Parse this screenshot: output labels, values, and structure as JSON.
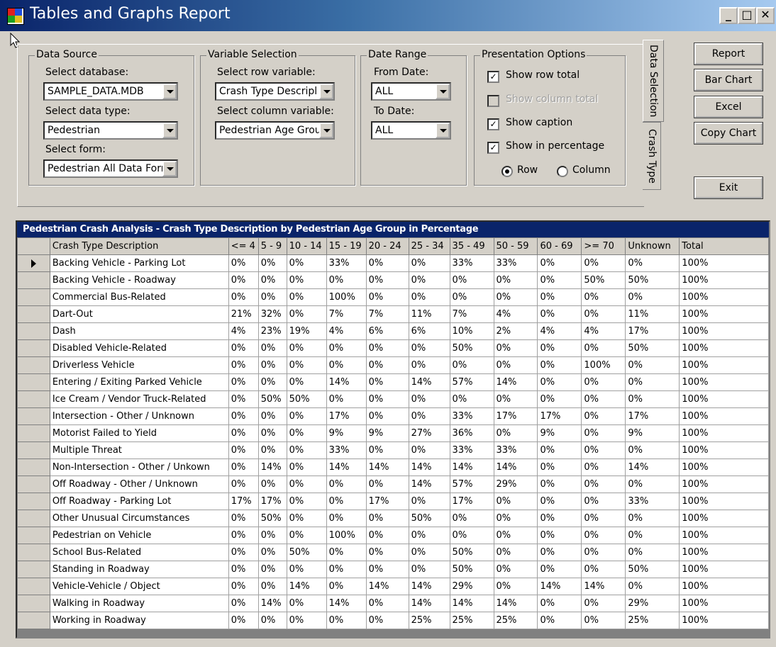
{
  "window": {
    "title": "Tables and Graphs Report"
  },
  "data_source": {
    "legend": "Data Source",
    "database_label": "Select database:",
    "database_value": "SAMPLE_DATA.MDB",
    "data_type_label": "Select data type:",
    "data_type_value": "Pedestrian",
    "form_label": "Select form:",
    "form_value": "Pedestrian All Data Forr"
  },
  "variable_selection": {
    "legend": "Variable Selection",
    "row_label": "Select row variable:",
    "row_value": "Crash Type Descripl",
    "column_label": "Select column variable:",
    "column_value": "Pedestrian Age Grou"
  },
  "date_range": {
    "legend": "Date Range",
    "from_label": "From Date:",
    "from_value": "ALL",
    "to_label": "To Date:",
    "to_value": "ALL"
  },
  "presentation": {
    "legend": "Presentation Options",
    "row_total": "Show row total",
    "column_total": "Show column total",
    "caption": "Show caption",
    "percentage": "Show in percentage",
    "row_radio": "Row",
    "column_radio": "Column"
  },
  "tabs": {
    "data_selection": "Data Selection",
    "crash_type": "Crash Type"
  },
  "buttons": {
    "report": "Report",
    "bar_chart": "Bar Chart",
    "excel": "Excel",
    "copy_chart": "Copy Chart",
    "exit": "Exit"
  },
  "grid": {
    "caption": "Pedestrian Crash Analysis - Crash Type Description by Pedestrian Age Group in Percentage",
    "columns": [
      "Crash Type Description",
      "<= 4",
      "5 - 9",
      "10 - 14",
      "15 - 19",
      "20 - 24",
      "25 - 34",
      "35 - 49",
      "50 - 59",
      "60 - 69",
      ">= 70",
      "Unknown",
      "Total"
    ],
    "rows": [
      [
        "Backing Vehicle - Parking Lot",
        "0%",
        "0%",
        "0%",
        "33%",
        "0%",
        "0%",
        "33%",
        "33%",
        "0%",
        "0%",
        "0%",
        "100%"
      ],
      [
        "Backing Vehicle - Roadway",
        "0%",
        "0%",
        "0%",
        "0%",
        "0%",
        "0%",
        "0%",
        "0%",
        "0%",
        "50%",
        "50%",
        "100%"
      ],
      [
        "Commercial Bus-Related",
        "0%",
        "0%",
        "0%",
        "100%",
        "0%",
        "0%",
        "0%",
        "0%",
        "0%",
        "0%",
        "0%",
        "100%"
      ],
      [
        "Dart-Out",
        "21%",
        "32%",
        "0%",
        "7%",
        "7%",
        "11%",
        "7%",
        "4%",
        "0%",
        "0%",
        "11%",
        "100%"
      ],
      [
        "Dash",
        "4%",
        "23%",
        "19%",
        "4%",
        "6%",
        "6%",
        "10%",
        "2%",
        "4%",
        "4%",
        "17%",
        "100%"
      ],
      [
        "Disabled Vehicle-Related",
        "0%",
        "0%",
        "0%",
        "0%",
        "0%",
        "0%",
        "50%",
        "0%",
        "0%",
        "0%",
        "50%",
        "100%"
      ],
      [
        "Driverless Vehicle",
        "0%",
        "0%",
        "0%",
        "0%",
        "0%",
        "0%",
        "0%",
        "0%",
        "0%",
        "100%",
        "0%",
        "100%"
      ],
      [
        "Entering / Exiting Parked Vehicle",
        "0%",
        "0%",
        "0%",
        "14%",
        "0%",
        "14%",
        "57%",
        "14%",
        "0%",
        "0%",
        "0%",
        "100%"
      ],
      [
        "Ice Cream / Vendor Truck-Related",
        "0%",
        "50%",
        "50%",
        "0%",
        "0%",
        "0%",
        "0%",
        "0%",
        "0%",
        "0%",
        "0%",
        "100%"
      ],
      [
        "Intersection - Other / Unknown",
        "0%",
        "0%",
        "0%",
        "17%",
        "0%",
        "0%",
        "33%",
        "17%",
        "17%",
        "0%",
        "17%",
        "100%"
      ],
      [
        "Motorist Failed to Yield",
        "0%",
        "0%",
        "0%",
        "9%",
        "9%",
        "27%",
        "36%",
        "0%",
        "9%",
        "0%",
        "9%",
        "100%"
      ],
      [
        "Multiple Threat",
        "0%",
        "0%",
        "0%",
        "33%",
        "0%",
        "0%",
        "33%",
        "33%",
        "0%",
        "0%",
        "0%",
        "100%"
      ],
      [
        "Non-Intersection - Other / Unkown",
        "0%",
        "14%",
        "0%",
        "14%",
        "14%",
        "14%",
        "14%",
        "14%",
        "0%",
        "0%",
        "14%",
        "100%"
      ],
      [
        "Off Roadway - Other / Unknown",
        "0%",
        "0%",
        "0%",
        "0%",
        "0%",
        "14%",
        "57%",
        "29%",
        "0%",
        "0%",
        "0%",
        "100%"
      ],
      [
        "Off Roadway - Parking Lot",
        "17%",
        "17%",
        "0%",
        "0%",
        "17%",
        "0%",
        "17%",
        "0%",
        "0%",
        "0%",
        "33%",
        "100%"
      ],
      [
        "Other Unusual Circumstances",
        "0%",
        "50%",
        "0%",
        "0%",
        "0%",
        "50%",
        "0%",
        "0%",
        "0%",
        "0%",
        "0%",
        "100%"
      ],
      [
        "Pedestrian on Vehicle",
        "0%",
        "0%",
        "0%",
        "100%",
        "0%",
        "0%",
        "0%",
        "0%",
        "0%",
        "0%",
        "0%",
        "100%"
      ],
      [
        "School Bus-Related",
        "0%",
        "0%",
        "50%",
        "0%",
        "0%",
        "0%",
        "50%",
        "0%",
        "0%",
        "0%",
        "0%",
        "100%"
      ],
      [
        "Standing in Roadway",
        "0%",
        "0%",
        "0%",
        "0%",
        "0%",
        "0%",
        "50%",
        "0%",
        "0%",
        "0%",
        "50%",
        "100%"
      ],
      [
        "Vehicle-Vehicle / Object",
        "0%",
        "0%",
        "14%",
        "0%",
        "14%",
        "14%",
        "29%",
        "0%",
        "14%",
        "14%",
        "0%",
        "100%"
      ],
      [
        "Walking in Roadway",
        "0%",
        "14%",
        "0%",
        "14%",
        "0%",
        "14%",
        "14%",
        "14%",
        "0%",
        "0%",
        "29%",
        "100%"
      ],
      [
        "Working in Roadway",
        "0%",
        "0%",
        "0%",
        "0%",
        "0%",
        "25%",
        "25%",
        "25%",
        "0%",
        "0%",
        "25%",
        "100%"
      ]
    ]
  }
}
